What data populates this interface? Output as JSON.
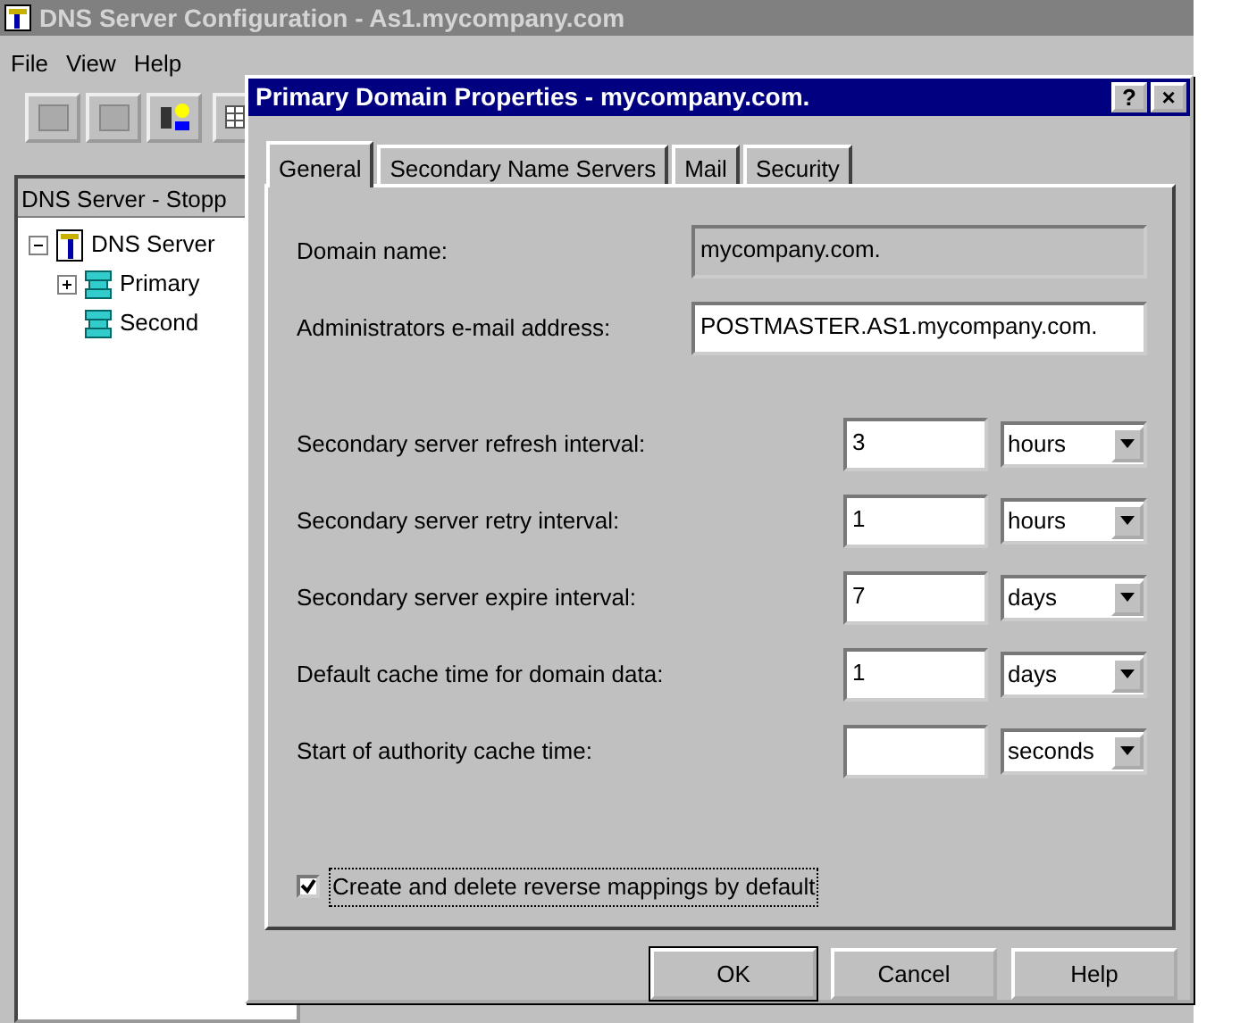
{
  "main_window": {
    "title": "DNS Server Configuration - As1.mycompany.com",
    "menu": [
      "File",
      "View",
      "Help"
    ],
    "pane_header": "DNS Server - Stopp",
    "tree": [
      {
        "label": "DNS Server",
        "expanded": true,
        "children": [
          {
            "label": "Primary",
            "expanded": false
          },
          {
            "label": "Second"
          }
        ]
      }
    ]
  },
  "dialog": {
    "title": "Primary Domain Properties - mycompany.com.",
    "title_buttons": [
      "?",
      "×"
    ],
    "tabs": [
      {
        "label": "General",
        "selected": true
      },
      {
        "label": "Secondary Name Servers",
        "selected": false
      },
      {
        "label": "Mail",
        "selected": false
      },
      {
        "label": "Security",
        "selected": false
      }
    ],
    "fields": [
      {
        "label": "Domain name:",
        "value": "mycompany.com.",
        "disabled": true
      },
      {
        "label": "Administrators e-mail address:",
        "value": "POSTMASTER.AS1.mycompany.com.",
        "disabled": false
      }
    ],
    "intervals": [
      {
        "label": "Secondary server refresh interval:",
        "value": "3",
        "unit": "hours"
      },
      {
        "label": "Secondary server retry interval:",
        "value": "1",
        "unit": "hours"
      },
      {
        "label": "Secondary server expire interval:",
        "value": "7",
        "unit": "days"
      },
      {
        "label": "Default cache time for domain data:",
        "value": "1",
        "unit": "days"
      },
      {
        "label": "Start of authority cache time:",
        "unit": "seconds"
      }
    ],
    "checkbox": {
      "label": "Create and delete reverse mappings by default",
      "checked": true
    },
    "buttons": [
      {
        "label": "OK",
        "default": true
      },
      {
        "label": "Cancel",
        "default": false
      },
      {
        "label": "Help",
        "default": false
      }
    ]
  }
}
